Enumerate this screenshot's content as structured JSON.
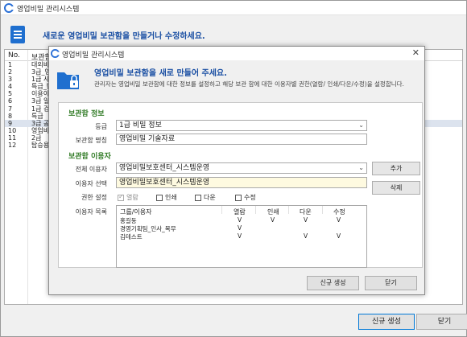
{
  "window": {
    "title": "영업비밀 관리시스템"
  },
  "banner": {
    "text": "새로운 영업비밀 보관함을 만들거나 수정하세요."
  },
  "list": {
    "headers": [
      "No.",
      "보관함"
    ],
    "rows": [
      {
        "no": "1",
        "name": "대외비"
      },
      {
        "no": "2",
        "name": "3급_영"
      },
      {
        "no": "3",
        "name": "1급 사"
      },
      {
        "no": "4",
        "name": "특급_팀"
      },
      {
        "no": "5",
        "name": "이용이"
      },
      {
        "no": "6",
        "name": "3급 일"
      },
      {
        "no": "7",
        "name": "1급 검수"
      },
      {
        "no": "8",
        "name": "특급"
      },
      {
        "no": "9",
        "name": "3급 공"
      },
      {
        "no": "10",
        "name": "영업비밀"
      },
      {
        "no": "11",
        "name": "2급"
      },
      {
        "no": "12",
        "name": "탑승용"
      }
    ],
    "selected_index": 8
  },
  "outer_buttons": {
    "create": "신규 생성",
    "close": "닫기"
  },
  "dialog": {
    "title": "영업비밀 관리시스템",
    "heading": "영업비밀 보관함을 새로 만들어 주세요.",
    "description": "관리자는 영업비밀 보관함에 대한 정보를 설정하고 해당 보관 함에 대한 이용자별 권한(열람/ 인쇄/다운/수정)을 설정합니다.",
    "section_info": "보관함 정보",
    "grade_label": "등급",
    "grade_value": "1급 비밀 정보",
    "name_label": "보관함 명칭",
    "name_value": "영업비밀 기술자료",
    "section_users": "보관함 이용자",
    "all_users_label": "전체 이용자",
    "all_users_value": "영업비밀보호센터_시스템운영",
    "selected_user_label": "이용자 선택",
    "selected_user_value": "영업비밀보호센터_시스템운영",
    "permission_label": "권한 설정",
    "permissions": [
      {
        "label": "열람",
        "checked": true
      },
      {
        "label": "인쇄",
        "checked": false
      },
      {
        "label": "다운",
        "checked": false
      },
      {
        "label": "수정",
        "checked": false
      }
    ],
    "user_list_label": "이용자 목록",
    "add_button": "추가",
    "delete_button": "삭제",
    "grid": {
      "headers": [
        "그룹/이용자",
        "열람",
        "인쇄",
        "다운",
        "수정"
      ],
      "rows": [
        {
          "name": "홍길동",
          "view": "V",
          "print": "V",
          "down": "V",
          "edit": "V"
        },
        {
          "name": "경영기획팀_인사_복무",
          "view": "V",
          "print": "",
          "down": "",
          "edit": ""
        },
        {
          "name": "김테스트",
          "view": "V",
          "print": "",
          "down": "V",
          "edit": "V"
        }
      ]
    },
    "create_button": "신규 생성",
    "close_button": "닫기"
  },
  "colors": {
    "accent": "#1a4fa3",
    "section": "#2f7a24",
    "yellow_field": "#fefae0"
  }
}
